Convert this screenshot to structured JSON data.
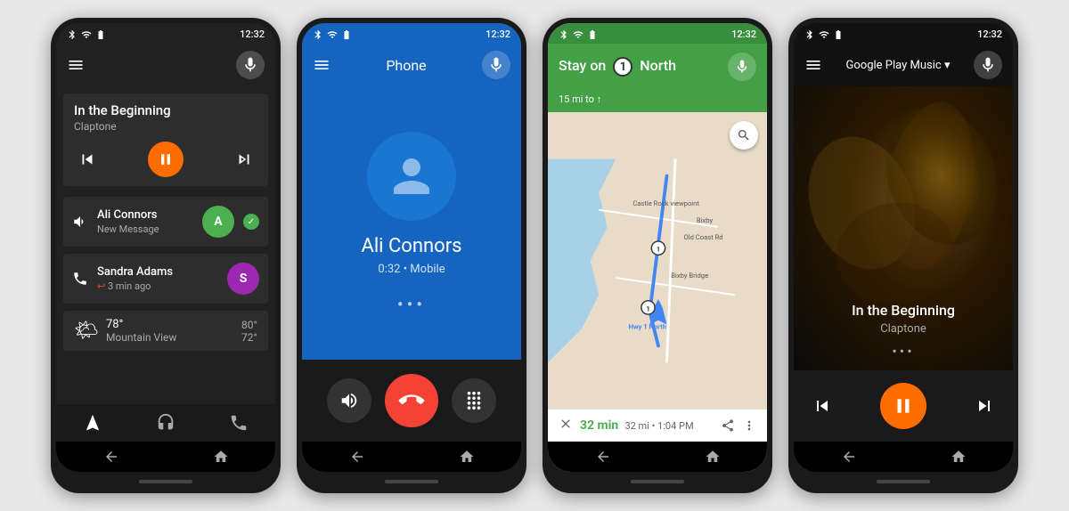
{
  "phones": {
    "phone1": {
      "status": {
        "time": "12:32"
      },
      "music": {
        "title": "In the Beginning",
        "artist": "Claptone"
      },
      "notifications": [
        {
          "icon": "message",
          "title": "Ali Connors",
          "subtitle": "New Message",
          "avatar_letter": "A",
          "avatar_color": "#4CAF50"
        },
        {
          "icon": "phone",
          "title": "Sandra Adams",
          "subtitle": "3 min ago",
          "avatar_letter": "S",
          "avatar_color": "#9C27B0"
        }
      ],
      "weather": {
        "temp": "78°",
        "hi": "80°",
        "lo": "72°",
        "city": "Mountain View"
      }
    },
    "phone2": {
      "status": {
        "time": "12:32"
      },
      "app_title": "Phone",
      "call": {
        "name": "Ali Connors",
        "status": "0:32 • Mobile"
      }
    },
    "phone3": {
      "status": {
        "time": "12:32"
      },
      "navigation": {
        "instruction": "Stay on",
        "road": "1",
        "direction": "North",
        "distance": "15 mi to ↑",
        "route_time": "32 min",
        "route_dist": "32 mi",
        "arrival": "1:04 PM"
      }
    },
    "phone4": {
      "status": {
        "time": "12:32"
      },
      "app_title": "Google Play Music",
      "music": {
        "title": "In the Beginning",
        "artist": "Claptone"
      }
    }
  }
}
